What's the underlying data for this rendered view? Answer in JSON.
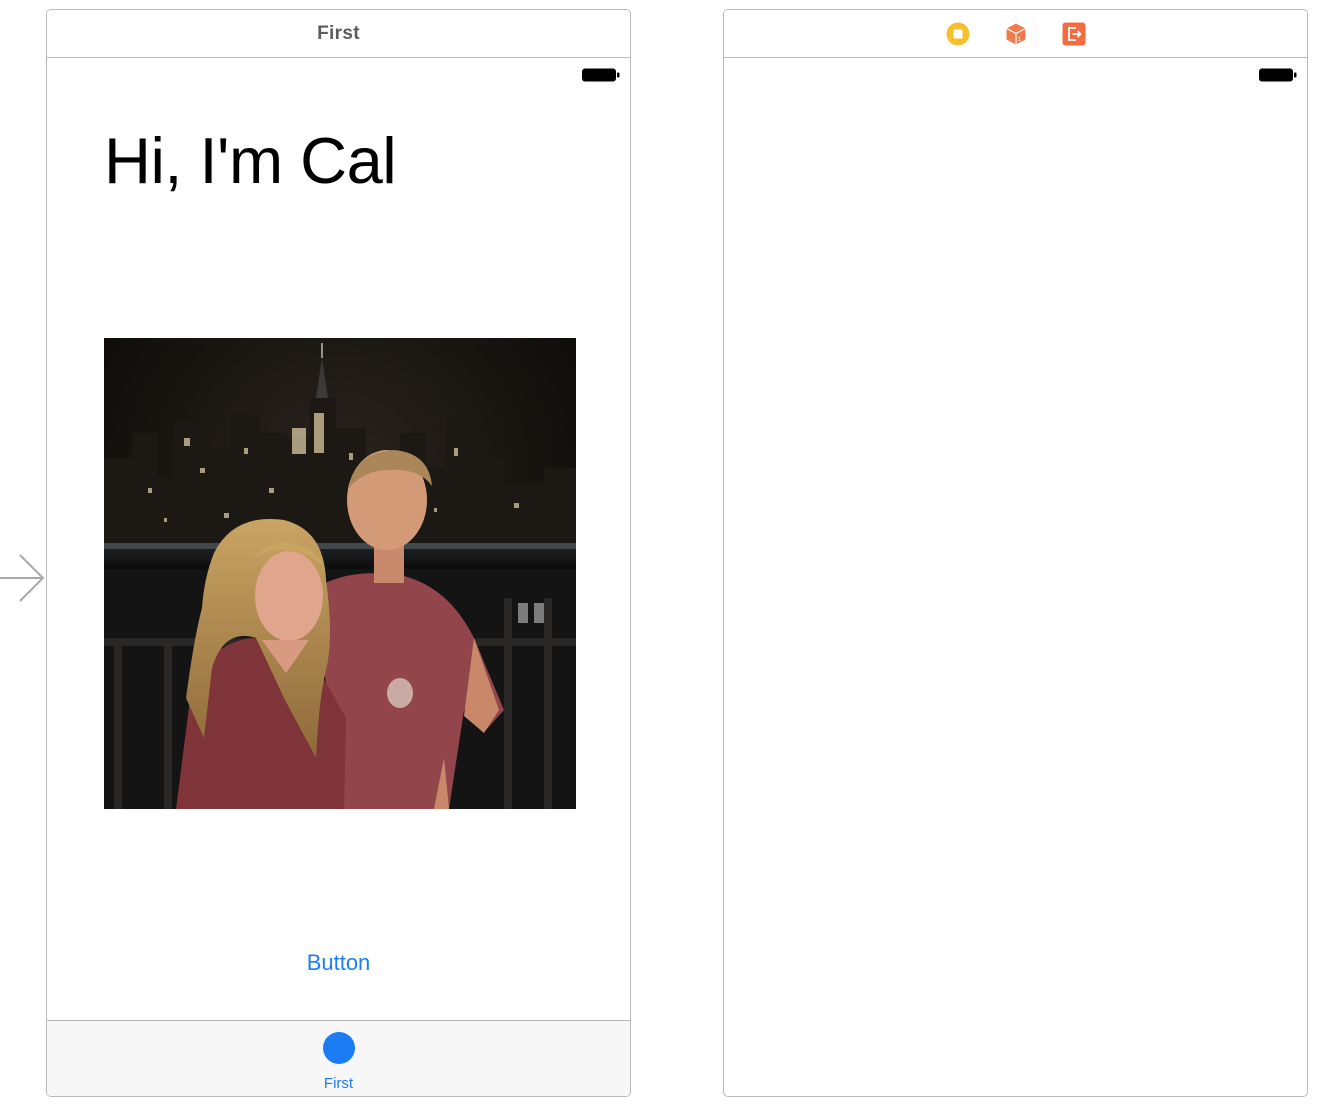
{
  "scenes": {
    "first": {
      "title": "First",
      "heading": "Hi, I'm Cal",
      "button_label": "Button",
      "tab_label": "First"
    },
    "second": {
      "dock_icons": [
        "view-controller-icon",
        "first-responder-icon",
        "exit-icon"
      ]
    }
  },
  "colors": {
    "tint": "#1c7cf4",
    "view_controller_icon": "#f5bf2e",
    "first_responder_icon": "#f07b4f",
    "exit_icon": "#f26c41",
    "frame_border": "#b9b9b9"
  }
}
